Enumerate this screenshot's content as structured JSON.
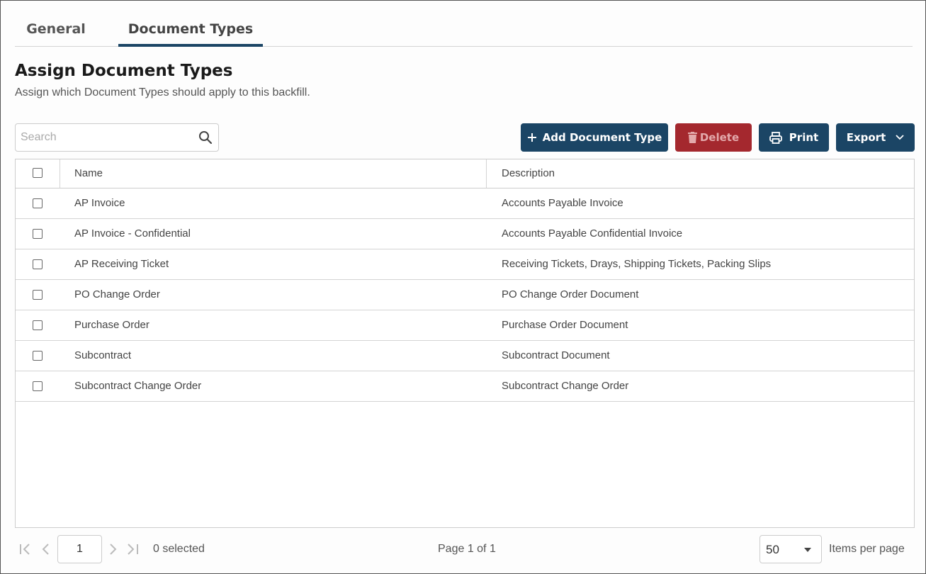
{
  "tabs": [
    {
      "label": "General",
      "active": false
    },
    {
      "label": "Document Types",
      "active": true
    }
  ],
  "header": {
    "title": "Assign Document Types",
    "subtitle": "Assign which Document Types should apply to this backfill."
  },
  "search": {
    "placeholder": "Search",
    "value": "",
    "icon": "search-icon"
  },
  "toolbar": {
    "add_label": "Add Document Type",
    "delete_label": "Delete",
    "print_label": "Print",
    "export_label": "Export"
  },
  "table": {
    "columns": [
      "Name",
      "Description"
    ],
    "rows": [
      {
        "name": "AP Invoice",
        "description": "Accounts Payable Invoice"
      },
      {
        "name": "AP Invoice - Confidential",
        "description": "Accounts Payable Confidential Invoice"
      },
      {
        "name": "AP Receiving Ticket",
        "description": "Receiving Tickets, Drays, Shipping Tickets, Packing Slips"
      },
      {
        "name": "PO Change Order",
        "description": "PO Change Order Document"
      },
      {
        "name": "Purchase Order",
        "description": "Purchase Order Document"
      },
      {
        "name": "Subcontract",
        "description": "Subcontract Document"
      },
      {
        "name": "Subcontract Change Order",
        "description": "Subcontract Change Order"
      }
    ]
  },
  "pager": {
    "current_page": "1",
    "selected_text": "0 selected",
    "page_info": "Page 1 of 1",
    "items_per_page": "50",
    "items_per_page_label": "Items per page"
  },
  "colors": {
    "primary": "#1b4565",
    "danger": "#a4282e"
  }
}
